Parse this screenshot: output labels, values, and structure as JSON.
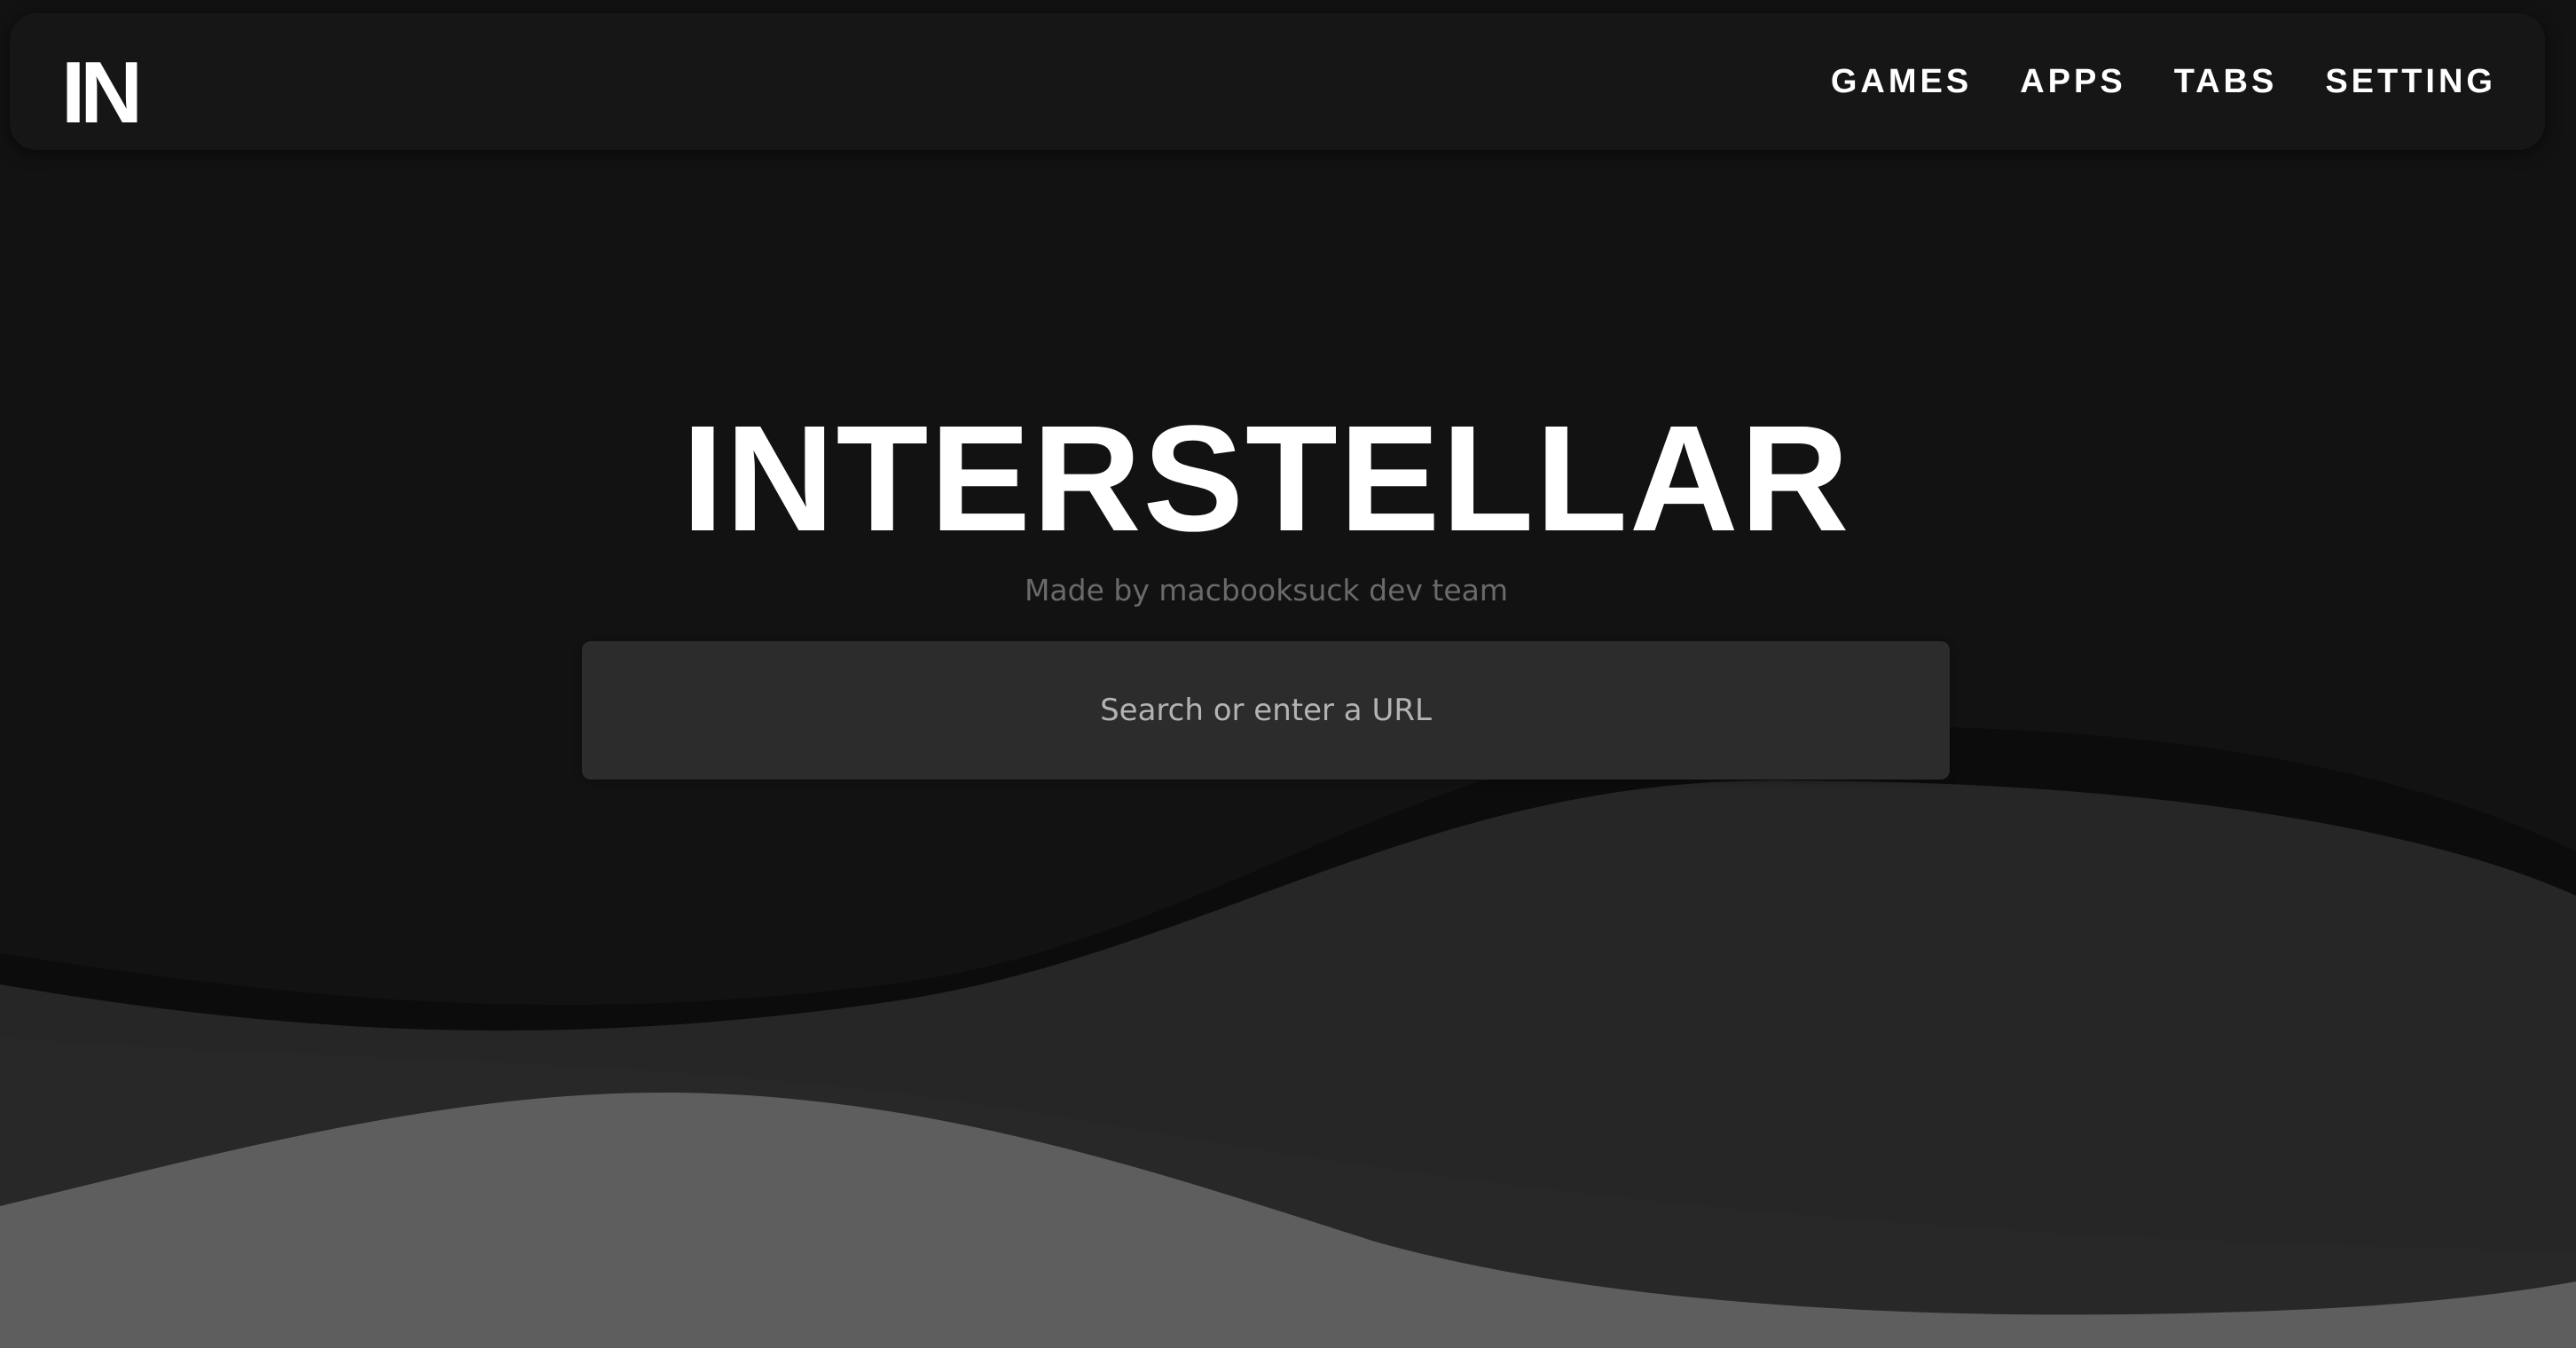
{
  "logo": {
    "text": "IN"
  },
  "nav": {
    "items": [
      {
        "label": "GAMES"
      },
      {
        "label": "APPS"
      },
      {
        "label": "TABS"
      },
      {
        "label": "SETTING"
      }
    ]
  },
  "hero": {
    "title": "INTERSTELLAR",
    "subtitle": "Made by macbooksuck dev team"
  },
  "search": {
    "value": "",
    "placeholder": "Search or enter a URL"
  },
  "colors": {
    "background": "#121212",
    "navbar": "#161616",
    "search_background": "#2c2c2c",
    "wave_dark": "#0c0c0c",
    "wave_mid": "#262626",
    "wave_light": "#5e5e5e",
    "text": "#ffffff",
    "subtitle_text": "#6a6a6a"
  }
}
